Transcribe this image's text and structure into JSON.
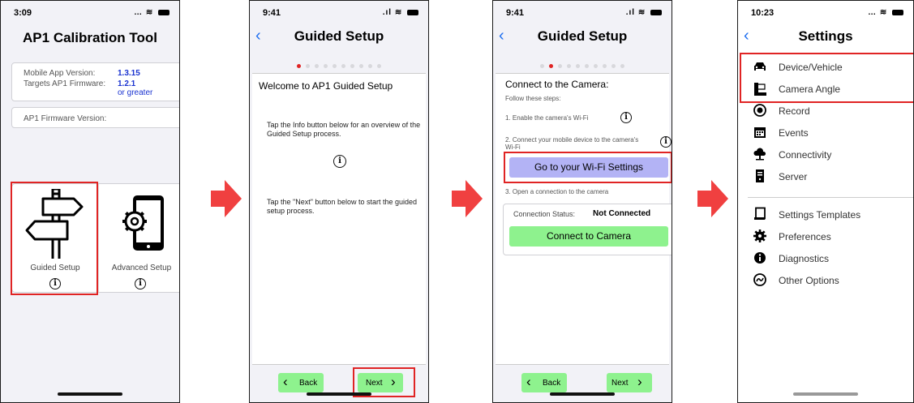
{
  "screen1": {
    "time": "3:09",
    "title": "AP1 Calibration Tool",
    "mobile_app_version_label": "Mobile App Version:",
    "mobile_app_version": "1.3.15",
    "targets_label": "Targets AP1 Firmware:",
    "targets_value": "1.2.1",
    "targets_suffix": "or greater",
    "firmware_label": "AP1 Firmware Version:",
    "guided_setup": "Guided Setup",
    "advanced_setup": "Advanced Setup",
    "info_glyph": "i"
  },
  "screen2": {
    "time": "9:41",
    "title": "Guided Setup",
    "welcome": "Welcome to AP1 Guided Setup",
    "para1": "Tap the Info button below for an overview of the Guided Setup process.",
    "para2": "Tap the \"Next\" button below to start the guided setup process.",
    "back": "Back",
    "next": "Next",
    "info_glyph": "i"
  },
  "screen3": {
    "time": "9:41",
    "title": "Guided Setup",
    "heading": "Connect to the Camera:",
    "follow": "Follow these steps:",
    "step1": "1. Enable the camera's Wi-Fi",
    "step2": "2. Connect your mobile device to the camera's Wi-Fi",
    "wifi_button": "Go to your Wi-Fi Settings",
    "step3": "3. Open a connection to the camera",
    "status_label": "Connection Status:",
    "status_value": "Not Connected",
    "connect_button": "Connect to Camera",
    "back": "Back",
    "next": "Next",
    "info_glyph": "i"
  },
  "screen4": {
    "time": "10:23",
    "title": "Settings",
    "items": [
      {
        "label": "Device/Vehicle",
        "icon": "car-icon"
      },
      {
        "label": "Camera Angle",
        "icon": "camera-angle-icon"
      },
      {
        "label": "Record",
        "icon": "record-icon"
      },
      {
        "label": "Events",
        "icon": "calendar-icon"
      },
      {
        "label": "Connectivity",
        "icon": "cloud-icon"
      },
      {
        "label": "Server",
        "icon": "server-icon"
      },
      {
        "label": "Settings Templates",
        "icon": "template-icon"
      },
      {
        "label": "Preferences",
        "icon": "gear-icon"
      },
      {
        "label": "Diagnostics",
        "icon": "info-icon"
      },
      {
        "label": "Other Options",
        "icon": "options-icon"
      }
    ]
  },
  "colors": {
    "highlight": "#e02424",
    "arrow": "#f04040",
    "value_blue": "#1a33d0",
    "button_green": "#8ef28e",
    "button_purple": "#b3b3f5",
    "nav_blue": "#1f6ff0"
  }
}
